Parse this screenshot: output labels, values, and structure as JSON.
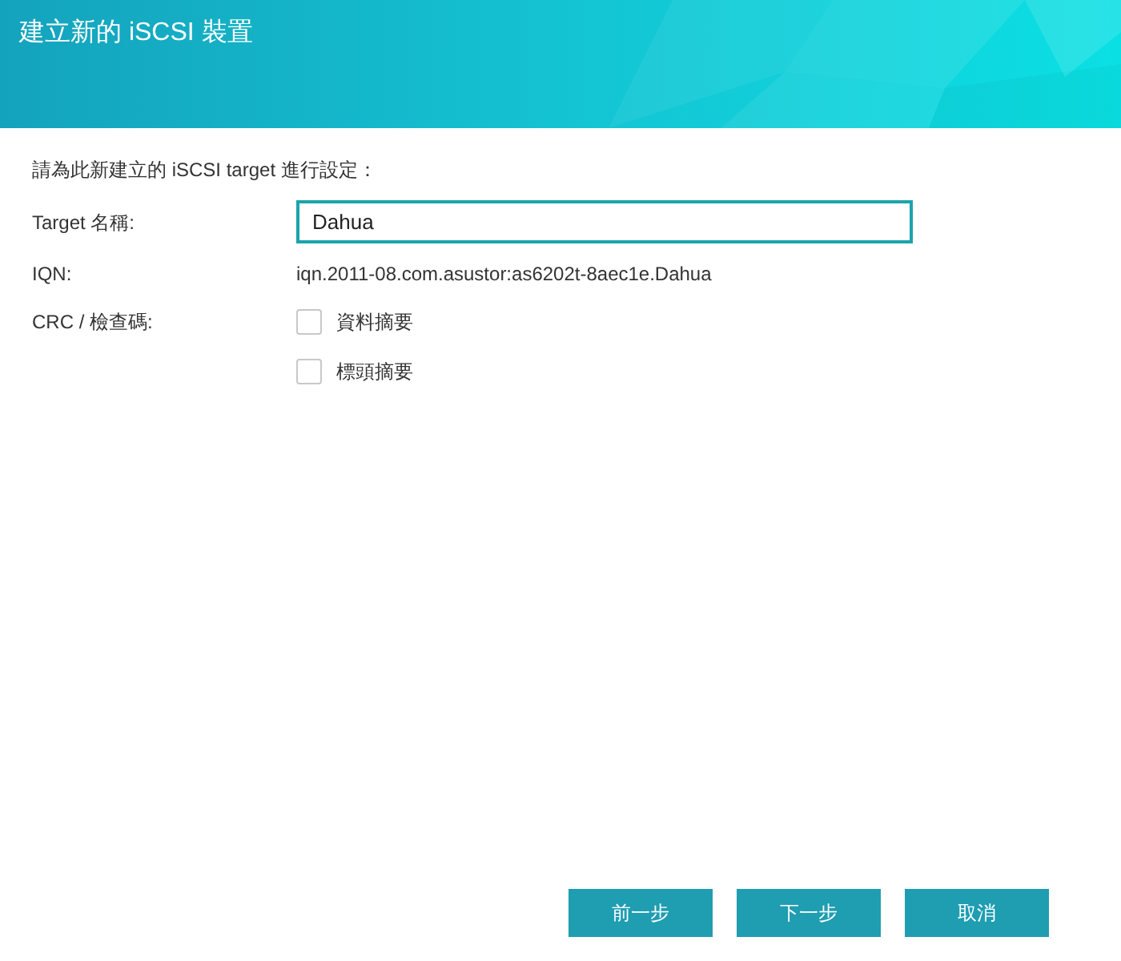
{
  "window": {
    "title": "建立新的 iSCSI 裝置"
  },
  "intro": "請為此新建立的 iSCSI target 進行設定：",
  "target_name": {
    "label": "Target 名稱:",
    "value": "Dahua"
  },
  "iqn": {
    "label": "IQN:",
    "value": "iqn.2011-08.com.asustor:as6202t-8aec1e.Dahua"
  },
  "crc": {
    "label": "CRC / 檢查碼:",
    "options": [
      {
        "label": "資料摘要",
        "checked": false
      },
      {
        "label": "標頭摘要",
        "checked": false
      }
    ]
  },
  "buttons": [
    "前一步",
    "下一步",
    "取消"
  ]
}
